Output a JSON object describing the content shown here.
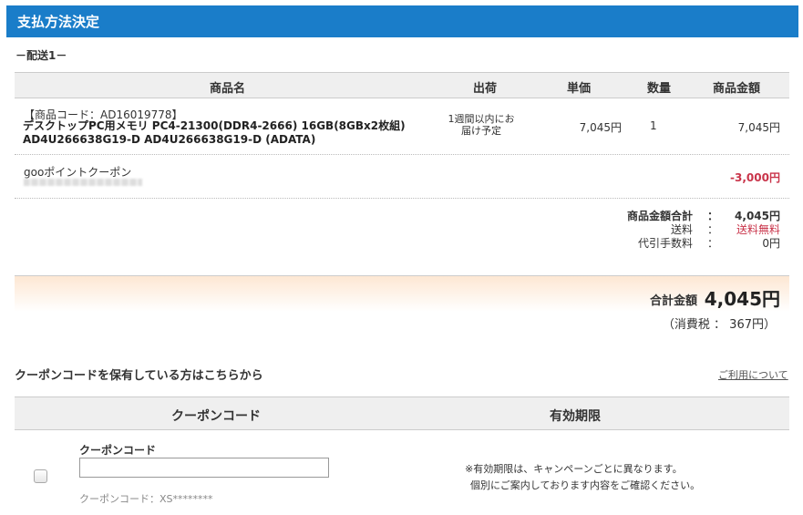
{
  "header": {
    "title": "支払方法決定"
  },
  "shipment": {
    "label": "－配送1－"
  },
  "table_headers": [
    "商品名",
    "出荷",
    "単価",
    "数量",
    "商品金額"
  ],
  "product": {
    "code": "【商品コード：AD16019778】",
    "name_line1": "デスクトップPC用メモリ PC4-21300(DDR4-2666) 16GB(8GBx2枚組)",
    "name_line2": "AD4U266638G19-D AD4U266638G19-D (ADATA)",
    "shipping_line1": "1週間以内にお",
    "shipping_line2": "届け予定",
    "unit_price": "7,045円",
    "quantity": "1",
    "amount": "7,045円"
  },
  "coupon_line": {
    "label": "gooポイントクーポン",
    "discount": "-3,000円"
  },
  "summary": {
    "subtotal_label": "商品金額合計",
    "subtotal_value": "4,045円",
    "shipping_label": "送料",
    "shipping_value": "送料無料",
    "cod_label": "代引手数料",
    "cod_value": "0円",
    "colon": "："
  },
  "total": {
    "label": "合計金額",
    "value": "4,045円",
    "tax": "（消費税 ： 367円）"
  },
  "coupon_section": {
    "title": "クーポンコードを保有している方はこちらから",
    "usage_link": "ご利用について",
    "col_code": "クーポンコード",
    "col_validity": "有効期限",
    "input_label": "クーポンコード",
    "input_value": "",
    "hint": "クーポンコード：XS********",
    "validity_note_line1": "※有効期限は、キャンペーンごとに異なります。",
    "validity_note_line2": "個別にご案内しております内容をご確認ください。"
  },
  "colors": {
    "header_bg": "#1a7dc9",
    "accent_red": "#c9344a"
  }
}
